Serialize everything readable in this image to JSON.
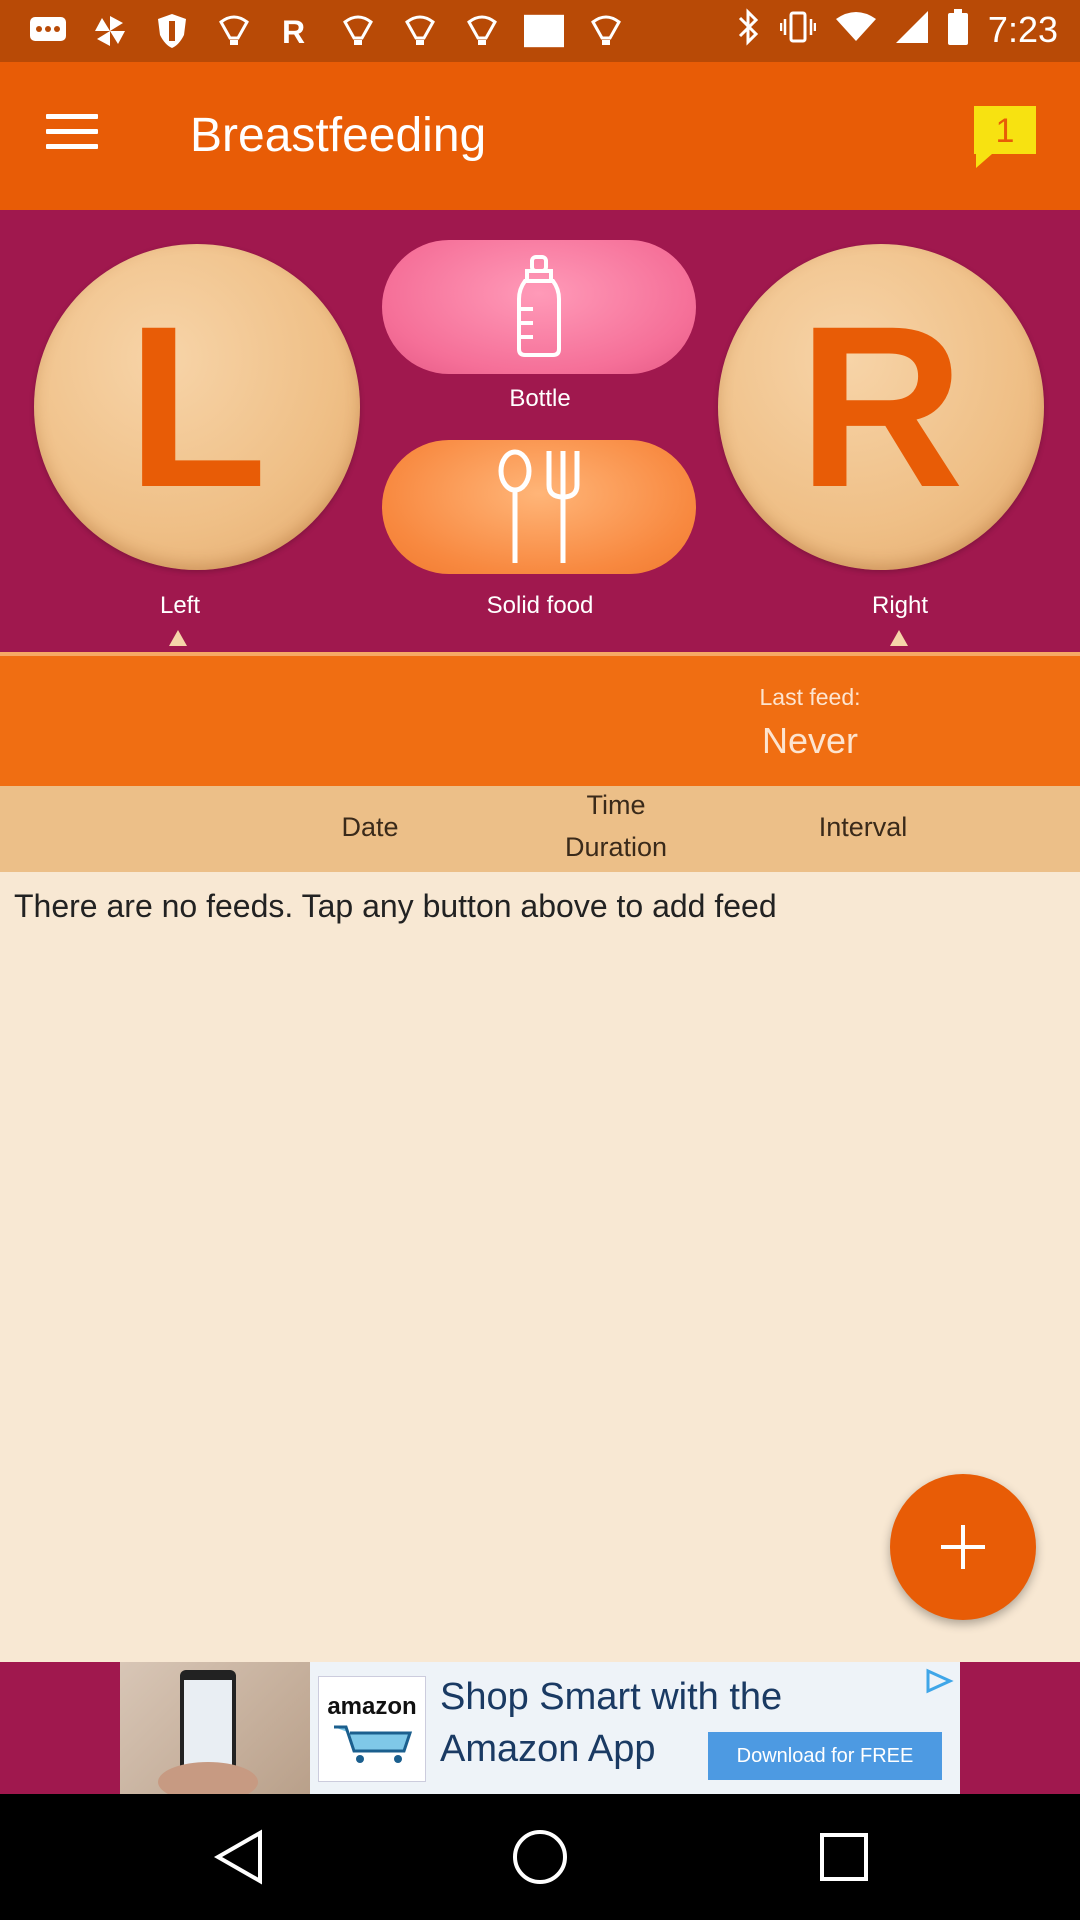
{
  "status_bar": {
    "time": "7:23",
    "icons": [
      "message-icon",
      "pinwheel-icon",
      "shield-icon",
      "bulb-icon",
      "r-app-icon",
      "bulb-icon",
      "bulb-icon",
      "bulb-icon",
      "blank-icon",
      "bulb-icon"
    ],
    "right_icons": [
      "bluetooth-icon",
      "vibrate-icon",
      "wifi-icon",
      "signal-icon",
      "battery-icon"
    ]
  },
  "app_bar": {
    "title": "Breastfeeding",
    "notification_count": "1"
  },
  "feed_buttons": {
    "left": {
      "letter": "L",
      "label": "Left"
    },
    "bottle": {
      "label": "Bottle"
    },
    "solid_food": {
      "label": "Solid food"
    },
    "right": {
      "letter": "R",
      "label": "Right"
    }
  },
  "last_feed": {
    "label": "Last feed:",
    "value": "Never"
  },
  "table_header": {
    "date": "Date",
    "time": "Time",
    "duration": "Duration",
    "interval": "Interval"
  },
  "empty_message": "There are no feeds. Tap any button above to add feed",
  "ad": {
    "brand": "amazon",
    "line1": "Shop Smart with the",
    "line2": "Amazon App",
    "cta": "Download for FREE"
  },
  "colors": {
    "app_bar": "#e85c06",
    "panel": "#a0184e",
    "last_feed_bar": "#f06e12",
    "header": "#ecbf88",
    "content": "#f8e8d3"
  }
}
